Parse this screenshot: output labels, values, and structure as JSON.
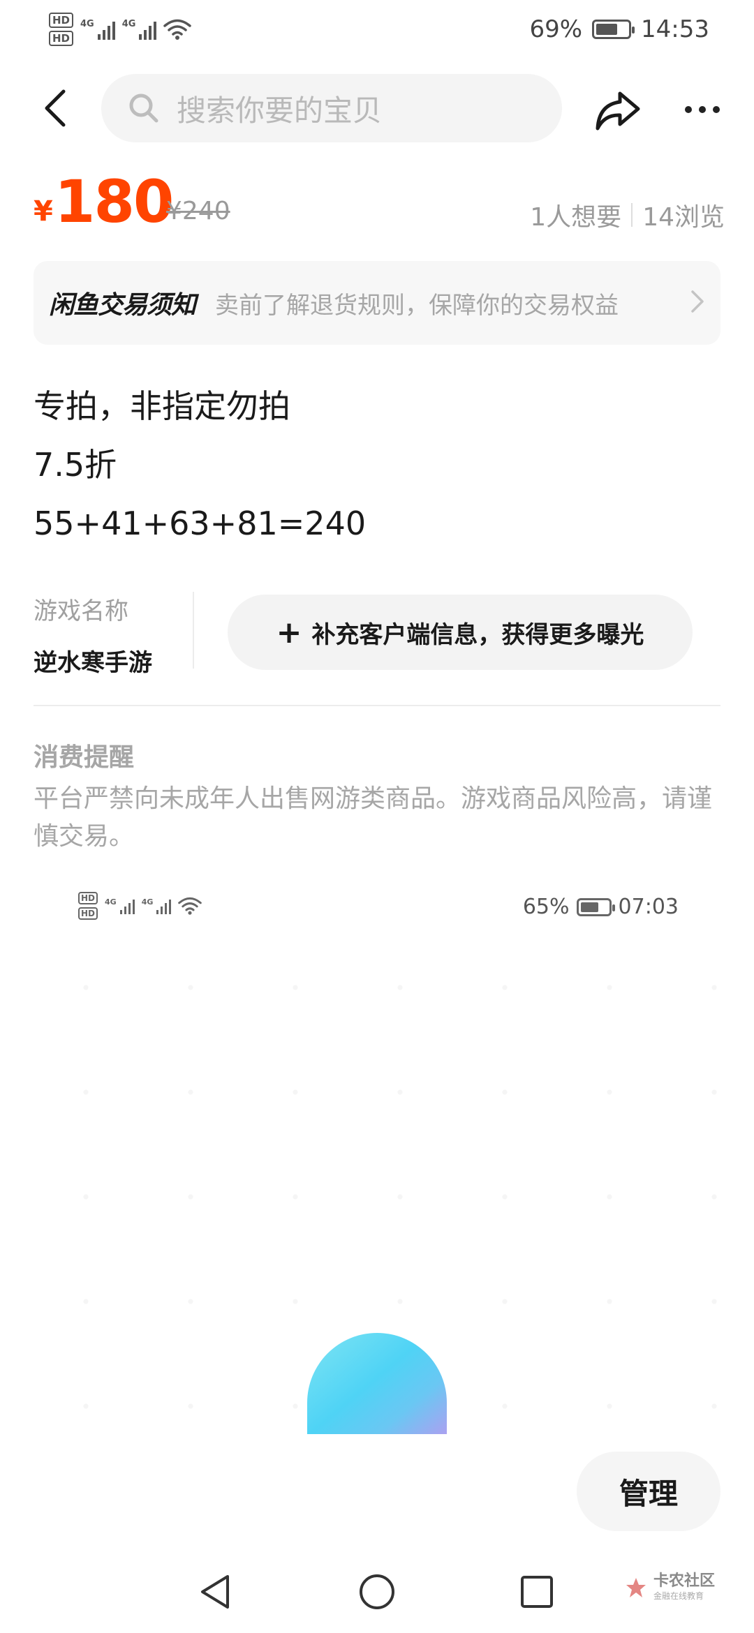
{
  "status_bar": {
    "hd1": "HD",
    "hd2": "HD",
    "net1": "4G",
    "net2": "4G",
    "battery_percent": "69%",
    "battery_level": 0.69,
    "time": "14:53"
  },
  "top_nav": {
    "search_placeholder": "搜索你要的宝贝"
  },
  "price": {
    "currency": "¥",
    "current": "180",
    "original": "¥240",
    "wants": "1人想要",
    "views": "14浏览"
  },
  "notice": {
    "title": "闲鱼交易须知",
    "text": "卖前了解退货规则，保障你的交易权益"
  },
  "description": {
    "lines": [
      "专拍，非指定勿拍",
      "7.5折",
      "55+41+63+81=240"
    ]
  },
  "attributes": {
    "label": "游戏名称",
    "value": "逆水寒手游",
    "add_button": "补充客户端信息，获得更多曝光"
  },
  "reminder": {
    "title": "消费提醒",
    "text": "平台严禁向未成年人出售网游类商品。游戏商品风险高，请谨慎交易。"
  },
  "embedded_screenshot": {
    "battery_percent": "65%",
    "battery_level": 0.65,
    "time": "07:03"
  },
  "actions": {
    "manage": "管理"
  },
  "watermark": {
    "brand": "卡农社区",
    "sub": "金融在线教育"
  },
  "colors": {
    "price": "#ff4400",
    "muted": "#a6a6a6"
  }
}
